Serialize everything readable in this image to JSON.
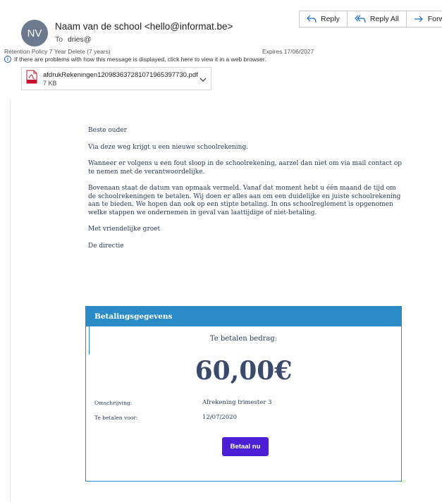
{
  "header": {
    "avatar_initials": "NV",
    "sender": "Naam van de school <hello@informat.be>",
    "to_label": "To",
    "to_value": "dries@",
    "retention": "Retention Policy  7 Year Delete (7 years)",
    "expires": "Expires  17/06/2027",
    "info_text": "If there are problems with how this message is displayed, click here to view it in a web browser."
  },
  "actions": {
    "reply": "Reply",
    "reply_all": "Reply All",
    "forward": "Forward"
  },
  "attachment": {
    "name": "afdrukRekeningen12098363728107196539773​0.pdf",
    "size": "7 KB",
    "icon_text": "PDF"
  },
  "body": {
    "greeting": "Beste ouder",
    "p1": "Via deze weg krijgt u een nieuwe schoolrekening.",
    "p2": "Wanneer er volgens u een fout sloop in de schoolrekening, aarzel dan niet om via mail contact op te nemen met de verantwoordelijke.",
    "p3": "Bovenaan staat de datum van opmaak vermeld. Vanaf dat moment hebt u één maand de tijd om de schoolrekeningen te betalen. Wij doen er alles aan om een duidelijke en juiste schoolrekening aan te bieden. We hopen dan ook op een stipte betaling. In ons schoolreglement is opgenomen welke stappen we ondernemen in geval van laattijdige of niet-betaling.",
    "closing": "Met vriendelijke groet",
    "signature": "De directie"
  },
  "payment": {
    "header": "Betalingsgegevens",
    "amount_label": "Te betalen bedrag:",
    "amount": "60,00€",
    "desc_label": "Omschrijving:",
    "desc_value": "Afrekening trimester 3",
    "due_label": "Te betalen voor:",
    "due_value": "12/07/2020",
    "button": "Betaal nu"
  },
  "colors": {
    "accent": "#2b8bc6",
    "button": "#4b1fd6",
    "text": "#2b3a55"
  }
}
